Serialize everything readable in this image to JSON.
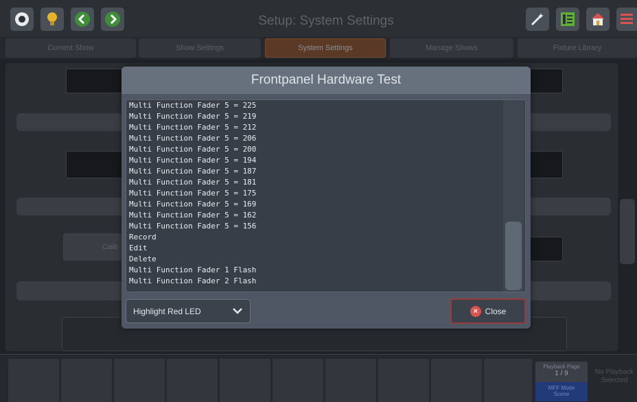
{
  "header": {
    "title": "Setup: System Settings",
    "left_icons": [
      "eye-icon",
      "lightbulb-icon",
      "back-arrow-icon",
      "forward-arrow-icon"
    ],
    "right_icons": [
      "magic-wand-icon",
      "list-panel-icon",
      "home-icon",
      "menu-icon"
    ]
  },
  "tabs": [
    {
      "label": "Current Show",
      "active": false
    },
    {
      "label": "Show Settings",
      "active": false
    },
    {
      "label": "System Settings",
      "active": true
    },
    {
      "label": "Manage Shows",
      "active": false
    },
    {
      "label": "Fixture Library",
      "active": false
    }
  ],
  "background": {
    "calib_label": "Calib"
  },
  "dialog": {
    "title": "Frontpanel Hardware Test",
    "log": [
      "Multi Function Fader 5 = 225",
      "Multi Function Fader 5 = 219",
      "Multi Function Fader 5 = 212",
      "Multi Function Fader 5 = 206",
      "Multi Function Fader 5 = 200",
      "Multi Function Fader 5 = 194",
      "Multi Function Fader 5 = 187",
      "Multi Function Fader 5 = 181",
      "Multi Function Fader 5 = 175",
      "Multi Function Fader 5 = 169",
      "Multi Function Fader 5 = 162",
      "Multi Function Fader 5 = 156",
      "Record",
      "Edit",
      "Delete",
      "Multi Function Fader 1 Flash",
      "Multi Function Fader 2 Flash"
    ],
    "select_value": "Highlight Red LED",
    "close_label": "Close"
  },
  "bottom": {
    "playback_page_label": "Playback Page",
    "playback_page_value": "1 / 9",
    "mff_mode_label": "MFF Mode",
    "mff_mode_value": "Scene",
    "no_playback_text": "No Playback Selected"
  },
  "colors": {
    "accent_tab": "#5a3a26",
    "close_border": "#9a3b3b",
    "mff_mode_bg": "#233a78"
  }
}
